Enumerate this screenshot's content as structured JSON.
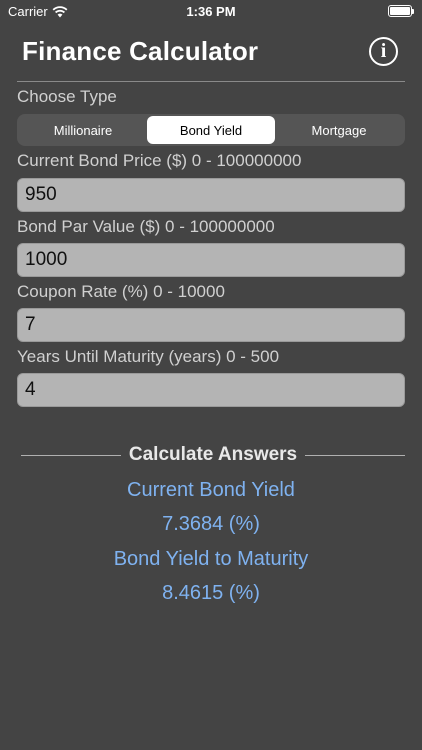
{
  "status_bar": {
    "carrier": "Carrier",
    "time": "1:36 PM"
  },
  "header": {
    "title": "Finance Calculator",
    "info_icon": "info-circle-icon"
  },
  "choose_type": {
    "label": "Choose Type",
    "options": [
      "Millionaire",
      "Bond Yield",
      "Mortgage"
    ],
    "selected": "Bond Yield"
  },
  "inputs": [
    {
      "label": "Current Bond Price ($) 0 - 100000000",
      "value": "950"
    },
    {
      "label": "Bond Par Value ($) 0 - 100000000",
      "value": "1000"
    },
    {
      "label": "Coupon Rate (%) 0 - 10000",
      "value": "7"
    },
    {
      "label": "Years Until Maturity (years) 0 - 500",
      "value": "4"
    }
  ],
  "answers": {
    "heading": "Calculate Answers",
    "items": [
      {
        "label": "Current Bond Yield",
        "value": "7.3684 (%)"
      },
      {
        "label": "Bond Yield to Maturity",
        "value": "8.4615 (%)"
      }
    ]
  },
  "colors": {
    "background": "#444444",
    "answer_text": "#7fb2f0",
    "field_bg": "#b4b4b4"
  }
}
